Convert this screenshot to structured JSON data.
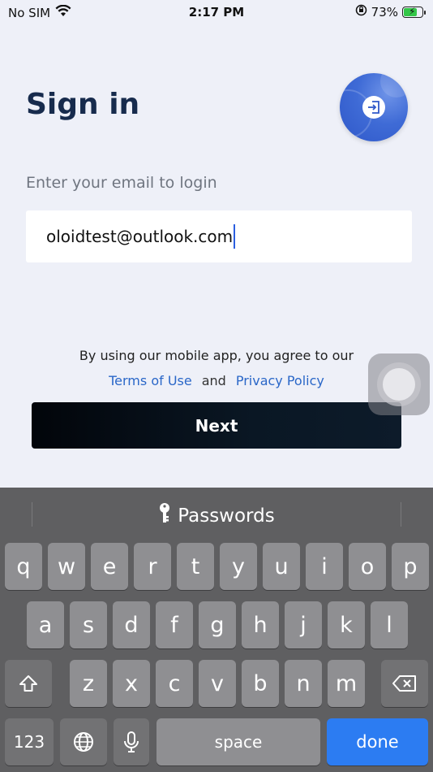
{
  "status_bar": {
    "carrier": "No SIM",
    "time": "2:17 PM",
    "battery_percent": "73%",
    "battery_level": 0.73,
    "battery_color": "#33c748"
  },
  "page": {
    "title": "Sign in",
    "badge_icon": "login-icon"
  },
  "form": {
    "email_label": "Enter your email to login",
    "email_value": "oloidtest@outlook.com"
  },
  "terms": {
    "agree_text": "By using our mobile app, you agree to our",
    "terms_link": "Terms of Use",
    "and_text": "and",
    "privacy_link": "Privacy Policy"
  },
  "actions": {
    "next_label": "Next"
  },
  "keyboard": {
    "suggestion_label": "Passwords",
    "row1": [
      "q",
      "w",
      "e",
      "r",
      "t",
      "y",
      "u",
      "i",
      "o",
      "p"
    ],
    "row2": [
      "a",
      "s",
      "d",
      "f",
      "g",
      "h",
      "j",
      "k",
      "l"
    ],
    "row3": [
      "z",
      "x",
      "c",
      "v",
      "b",
      "n",
      "m"
    ],
    "numbers_label": "123",
    "space_label": "space",
    "done_label": "done",
    "accent_color": "#2c7cf2"
  }
}
